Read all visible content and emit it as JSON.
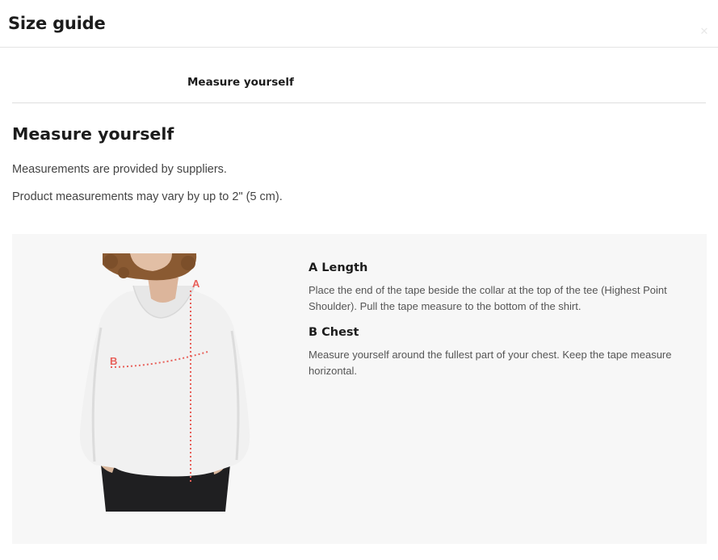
{
  "modal": {
    "title": "Size guide",
    "close_icon": "close-icon"
  },
  "tabs": [
    {
      "label": "Measure yourself",
      "active": true
    }
  ],
  "section": {
    "title": "Measure yourself",
    "paragraphs": [
      "Measurements are provided by suppliers.",
      "Product measurements may vary by up to 2\" (5 cm)."
    ]
  },
  "guide": {
    "image_labels": {
      "a": "A",
      "b": "B"
    },
    "measurements": [
      {
        "title": "A Length",
        "description": "Place the end of the tape beside the collar at the top of the tee (Highest Point Shoulder). Pull the tape measure to the bottom of the shirt."
      },
      {
        "title": "B Chest",
        "description": "Measure yourself around the fullest part of your chest. Keep the tape measure horizontal."
      }
    ]
  },
  "colors": {
    "panel_bg": "#f7f7f7",
    "marker": "#e8605a",
    "text_primary": "#1c1c1c",
    "text_secondary": "#555555"
  }
}
